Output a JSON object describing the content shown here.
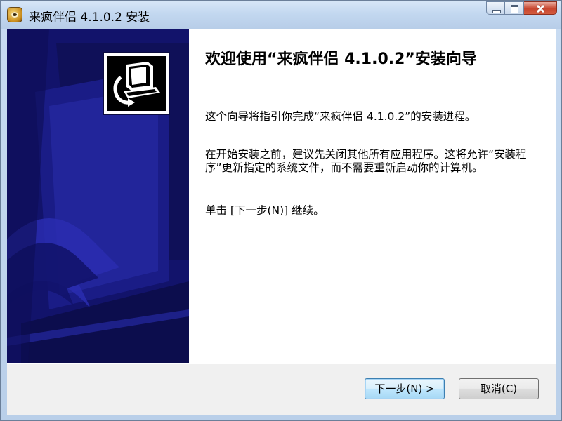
{
  "window": {
    "title": "来疯伴侣 4.1.0.2 安装",
    "icon": "app-icon"
  },
  "caption_buttons": {
    "minimize": "minimize-icon",
    "maximize": "maximize-icon",
    "close": "close-icon"
  },
  "sidebar": {
    "logo": "installer-logo-icon",
    "background_color": "#12136b"
  },
  "content": {
    "heading": "欢迎使用“来疯伴侣 4.1.0.2”安装向导",
    "paragraph1": "这个向导将指引你完成“来疯伴侣 4.1.0.2”的安装进程。",
    "paragraph2": "在开始安装之前，建议先关闭其他所有应用程序。这将允许“安装程序”更新指定的系统文件，而不需要重新启动你的计算机。",
    "paragraph3": "单击 [下一步(N)] 继续。"
  },
  "buttons": {
    "next_label": "下一步(N) >",
    "cancel_label": "取消(C)"
  }
}
